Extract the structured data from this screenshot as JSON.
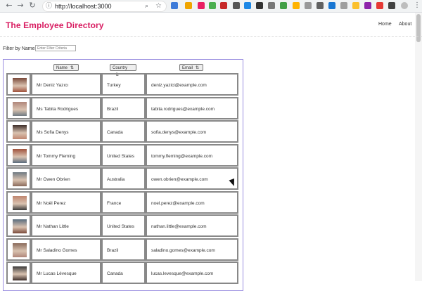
{
  "browser": {
    "url": "http://localhost:3000",
    "accent": "#d81b60"
  },
  "app": {
    "title": "The Employee Directory",
    "nav": [
      {
        "label": "Home"
      },
      {
        "label": "About"
      }
    ]
  },
  "filter": {
    "label": "Filter by Name:",
    "placeholder": "Enter Filter Criteria",
    "value": ""
  },
  "columns": [
    {
      "label": "Name",
      "icon": "sort-icon"
    },
    {
      "label": "Country",
      "icon": "sort-icon"
    },
    {
      "label": "Email",
      "icon": "sort-icon"
    }
  ],
  "employees": [
    {
      "name": "Mr Deniz Yazıcı",
      "country": "Turkey",
      "email": "deniz.yazici@example.com"
    },
    {
      "name": "Ms Tabita Rodrigues",
      "country": "Brazil",
      "email": "tabita.rodrigues@example.com"
    },
    {
      "name": "Ms Sofia Denys",
      "country": "Canada",
      "email": "sofia.denys@example.com"
    },
    {
      "name": "Mr Tommy Fleming",
      "country": "United States",
      "email": "tommy.fleming@example.com"
    },
    {
      "name": "Mr Owen Obrien",
      "country": "Australia",
      "email": "owen.obrien@example.com"
    },
    {
      "name": "Mr Noël Perez",
      "country": "France",
      "email": "noel.perez@example.com"
    },
    {
      "name": "Mr Nathan Little",
      "country": "United States",
      "email": "nathan.little@example.com"
    },
    {
      "name": "Mr Saladino Gomes",
      "country": "Brazil",
      "email": "saladino.gomes@example.com"
    },
    {
      "name": "Mr Lucas Lévesque",
      "country": "Canada",
      "email": "lucas.levesque@example.com"
    }
  ]
}
